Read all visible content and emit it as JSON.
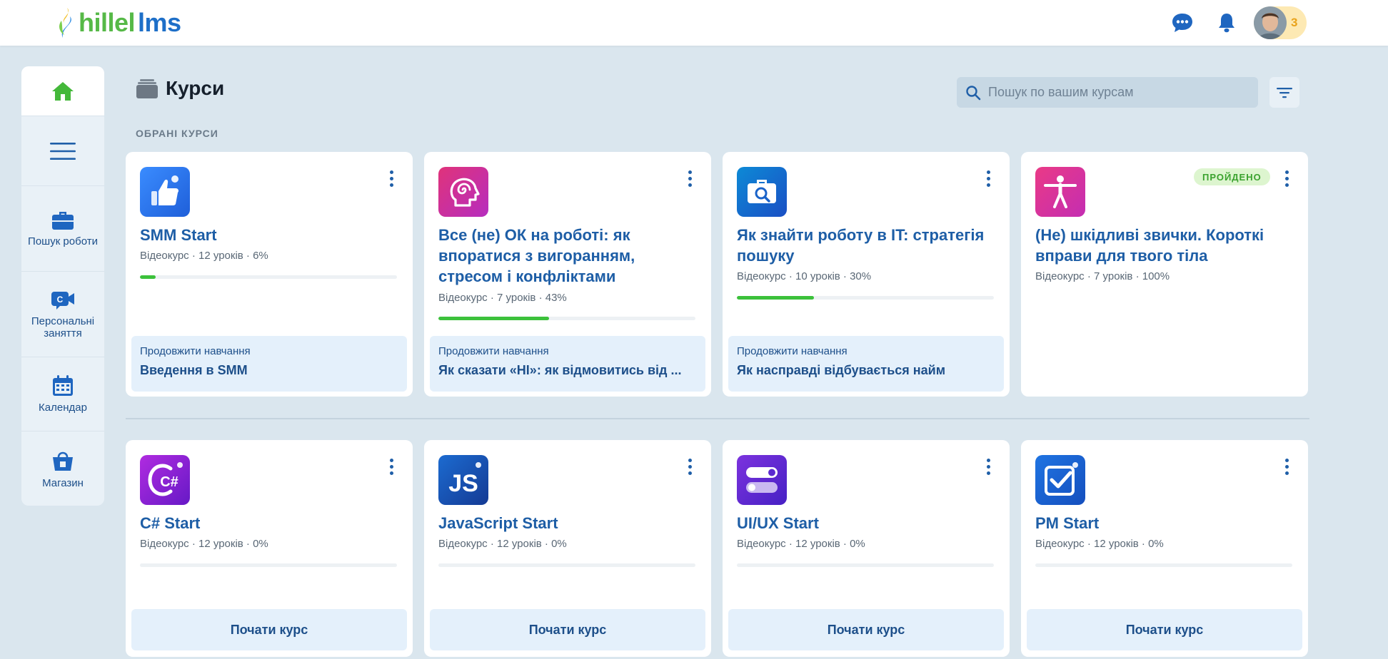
{
  "header": {
    "logo_hillel": "hillel",
    "logo_lms": "lms",
    "chat_icon": "chat-bubble-icon",
    "bell_icon": "bell-icon",
    "notification_count": "3"
  },
  "sidebar": {
    "items": [
      {
        "label": "",
        "icon": "home-icon",
        "active": true
      },
      {
        "label": "",
        "icon": "menu-icon"
      },
      {
        "label": "Пошук роботи",
        "icon": "briefcase-icon"
      },
      {
        "label": "Персональні заняття",
        "icon": "video-lesson-icon"
      },
      {
        "label": "Календар",
        "icon": "calendar-icon"
      },
      {
        "label": "Магазин",
        "icon": "shopping-bag-icon"
      }
    ]
  },
  "page": {
    "title": "Курси",
    "search_placeholder": "Пошук по вашим курсам",
    "section_favorites": "ОБРАНІ КУРСИ"
  },
  "favorites": [
    {
      "title": "SMM Start",
      "meta": "Відеокурс · 12 уроків · 6%",
      "progress": 6,
      "continue_label": "Продовжити навчання",
      "continue_lesson": "Введення в SMM",
      "icon": "thumbs-up-icon",
      "colors": [
        "#1f6fe0",
        "#3a8cff"
      ]
    },
    {
      "title": "Все (не) ОК на роботі: як впоратися з вигоранням, стресом і конфліктами",
      "meta": "Відеокурс · 7 уроків · 43%",
      "progress": 43,
      "continue_label": "Продовжити навчання",
      "continue_lesson": "Як сказати «НІ»: як відмовитись від ...",
      "icon": "head-spiral-icon",
      "colors": [
        "#e0337a",
        "#b62dbf"
      ]
    },
    {
      "title": "Як знайти роботу в IT: стратегія пошуку",
      "meta": "Відеокурс · 10 уроків · 30%",
      "progress": 30,
      "continue_label": "Продовжити навчання",
      "continue_lesson": "Як насправді відбувається найм",
      "icon": "briefcase-search-icon",
      "colors": [
        "#0d7fd0",
        "#1a54c9"
      ]
    },
    {
      "title": "(Не) шкідливі звички. Короткі вправи для твого тіла",
      "meta": "Відеокурс · 7 уроків · 100%",
      "progress": 100,
      "badge": "ПРОЙДЕНО",
      "icon": "stretching-person-icon",
      "colors": [
        "#ea3a86",
        "#c42db2"
      ]
    }
  ],
  "courses": [
    {
      "title": "C# Start",
      "meta": "Відеокурс · 12 уроків · 0%",
      "progress": 0,
      "start_label": "Почати курс",
      "icon": "csharp-icon",
      "glyph": "C#",
      "colors": [
        "#a423d8",
        "#6b1ac9"
      ]
    },
    {
      "title": "JavaScript Start",
      "meta": "Відеокурс · 12 уроків · 0%",
      "progress": 0,
      "start_label": "Почати курс",
      "icon": "javascript-icon",
      "glyph": "JS",
      "colors": [
        "#1c63c6",
        "#143f9b"
      ]
    },
    {
      "title": "UI/UX Start",
      "meta": "Відеокурс · 12 уроків · 0%",
      "progress": 0,
      "start_label": "Почати курс",
      "icon": "toggle-switch-icon",
      "colors": [
        "#7a2fdc",
        "#4b22c8"
      ]
    },
    {
      "title": "PM Start",
      "meta": "Відеокурс · 12 уроків · 0%",
      "progress": 0,
      "start_label": "Почати курс",
      "icon": "checkbox-icon",
      "colors": [
        "#1c6fe0",
        "#1550bf"
      ]
    }
  ]
}
